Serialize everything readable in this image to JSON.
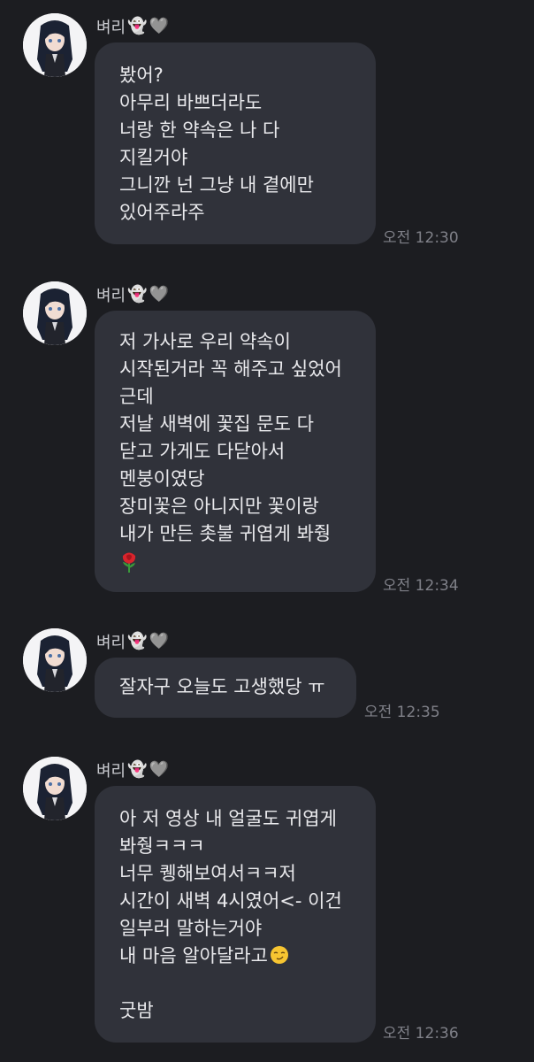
{
  "messages": [
    {
      "sender": "벼리",
      "lines": [
        "봤어?",
        "아무리 바쁘더라도",
        "너랑 한 약속은 나 다",
        "지킬거야",
        "그니깐 넌 그냥 내 곁에만",
        "있어주라주"
      ],
      "time": "오전 12:30"
    },
    {
      "sender": "벼리",
      "lines": [
        "저 가사로 우리 약속이",
        "시작된거라 꼭 해주고 싶었어",
        "근데",
        "저날 새벽에 꽃집 문도 다",
        "닫고 가게도 다닫아서",
        "멘붕이였당",
        "장미꽃은 아니지만 꽃이랑",
        "내가 만든 촛불 귀엽게 봐줭"
      ],
      "time": "오전 12:34"
    },
    {
      "sender": "벼리",
      "lines": [
        "잘자구 오늘도 고생했당 ㅠ"
      ],
      "time": "오전 12:35"
    },
    {
      "sender": "벼리",
      "lines": [
        "아 저 영상 내 얼굴도 귀엽게",
        "봐줭ㅋㅋㅋ",
        "너무 퀭해보여서ㅋㅋ저",
        "시간이 새벽 4시였어<- 이건",
        "일부러 말하는거야",
        "내 마음 알아달라고",
        "",
        "굿밤"
      ],
      "time": "오전 12:36"
    }
  ],
  "icons": {
    "sender_suffix": [
      "ghost-icon",
      "heart-icon"
    ],
    "msg2_last_line": "rose-icon",
    "msg4_line6_suffix": "smirk-icon"
  },
  "colors": {
    "background": "#1c1d21",
    "bubble": "#30323a",
    "text": "#e9e9ec",
    "time": "#7f8088"
  }
}
